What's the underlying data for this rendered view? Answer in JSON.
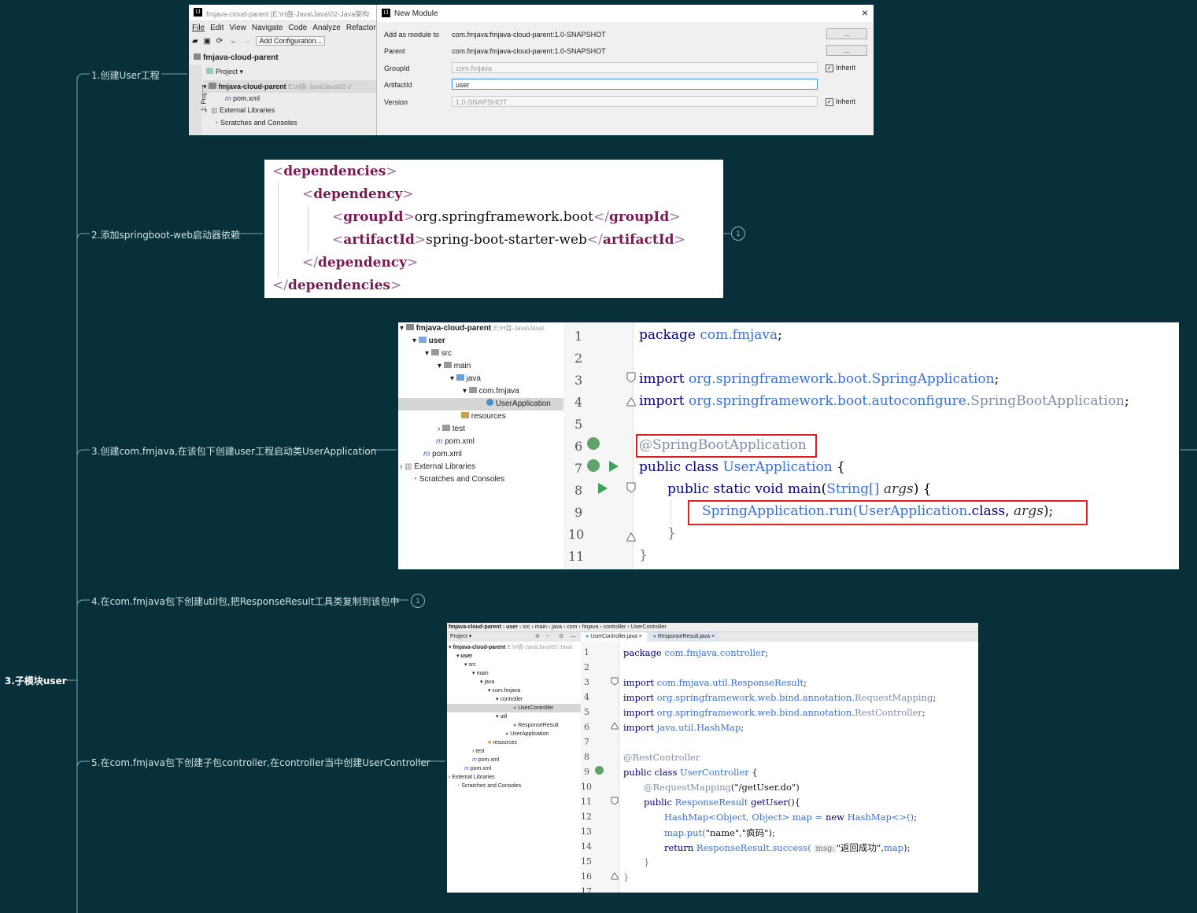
{
  "mindmap": {
    "root": "3.子模块user",
    "branches": [
      {
        "label": "1.创建User工程"
      },
      {
        "label": "2.添加springboot-web启动器依赖",
        "badge": "1"
      },
      {
        "label": "3.创建com.fmjava,在该包下创建user工程启动类UserApplication"
      },
      {
        "label": "4.在com.fmjava包下创建util包,把ResponseResult工具类复制到该包中",
        "badge": "1"
      },
      {
        "label": "5.在com.fmjava包下创建子包controller,在controller当中创建UserController"
      }
    ]
  },
  "shot1": {
    "ide_title": "fmjava-cloud-parent [E:\\H盘-Java\\Java\\02-Java架构",
    "menu": [
      "File",
      "Edit",
      "View",
      "Navigate",
      "Code",
      "Analyze",
      "Refactor"
    ],
    "add_config": "Add Configuration...",
    "project_root": "fmjava-cloud-parent",
    "project_dropdown": "Project",
    "side_tab": "1: Project",
    "tree": [
      {
        "label": "fmjava-cloud-parent",
        "hint": "E:\\H盘-Java\\Java\\02-J"
      },
      {
        "label": "pom.xml"
      },
      {
        "label": "External Libraries"
      },
      {
        "label": "Scratches and Consoles"
      }
    ],
    "dialog": {
      "title": "New Module",
      "close": "×",
      "add_as_module_label": "Add as module to",
      "add_as_module_value": "com.fmjava:fmjava-cloud-parent:1.0-SNAPSHOT",
      "parent_label": "Parent",
      "parent_value": "com.fmjava:fmjava-cloud-parent:1.0-SNAPSHOT",
      "groupid_label": "GroupId",
      "groupid_value": "com.fmjava",
      "artifactid_label": "ArtifactId",
      "artifactid_value": "user",
      "version_label": "Version",
      "version_value": "1.0-SNAPSHOT",
      "browse": "...",
      "inherit": "Inherit"
    }
  },
  "shot2": {
    "lines": [
      {
        "open": "dependencies"
      },
      {
        "open": "dependency"
      },
      {
        "tag": "groupId",
        "text": "org.springframework.boot"
      },
      {
        "tag": "artifactId",
        "text": "spring-boot-starter-web"
      },
      {
        "close": "dependency"
      },
      {
        "close": "dependencies"
      }
    ]
  },
  "shot3": {
    "tree": [
      {
        "label": "fmjava-cloud-parent",
        "hint": "E:\\H盘-Java\\Java\\"
      },
      {
        "label": "user"
      },
      {
        "label": "src"
      },
      {
        "label": "main"
      },
      {
        "label": "java"
      },
      {
        "label": "com.fmjava"
      },
      {
        "label": "UserApplication"
      },
      {
        "label": "resources"
      },
      {
        "label": "test"
      },
      {
        "label": "pom.xml"
      },
      {
        "label": "pom.xml"
      },
      {
        "label": "External Libraries"
      },
      {
        "label": "Scratches and Consoles"
      }
    ],
    "line_numbers": [
      "1",
      "2",
      "3",
      "4",
      "5",
      "6",
      "7",
      "8",
      "9",
      "10",
      "11"
    ],
    "code": {
      "l1_kw": "package",
      "l1_pk": "com.fmjava",
      "l1_end": ";",
      "l3_kw": "import",
      "l3_pk": "org.springframework.boot.",
      "l3_cls": "SpringApplication",
      "l3_end": ";",
      "l4_kw": "import",
      "l4_pk": "org.springframework.boot.autoconfigure.",
      "l4_cls": "SpringBootApplication",
      "l4_end": ";",
      "l6_ann": "@SpringBootApplication",
      "l7_kw": "public class",
      "l7_cls": "UserApplication",
      "l7_end": "{",
      "l8_kw": "public static void",
      "l8_fn": "main",
      "l8_p1": "(",
      "l8_type": "String[]",
      "l8_arg": "args",
      "l8_end": ") {",
      "l9_cls": "SpringApplication",
      "l9_fn": ".run(",
      "l9_arg1": "UserApplication",
      "l9_kw": ".class",
      "l9_sep": ", ",
      "l9_arg2": "args",
      "l9_end": ");",
      "l10": "}",
      "l11": "}"
    }
  },
  "shot4": {
    "breadcrumb": [
      "fmjava-cloud-parent",
      "user",
      "src",
      "main",
      "java",
      "com",
      "fmjava",
      "controller",
      "UserController"
    ],
    "project_dropdown": "Project",
    "tabs": [
      "UserController.java",
      "ResponseResult.java"
    ],
    "tree": [
      {
        "label": "fmjava-cloud-parent",
        "hint": "E:\\H盘-Java\\Java\\02-Java\\"
      },
      {
        "label": "user"
      },
      {
        "label": "src"
      },
      {
        "label": "main"
      },
      {
        "label": "java"
      },
      {
        "label": "com.fmjava"
      },
      {
        "label": "controller"
      },
      {
        "label": "UserController"
      },
      {
        "label": "util"
      },
      {
        "label": "ResponseResult"
      },
      {
        "label": "UserApplication"
      },
      {
        "label": "resources"
      },
      {
        "label": "test"
      },
      {
        "label": "pom.xml"
      },
      {
        "label": "pom.xml"
      },
      {
        "label": "External Libraries"
      },
      {
        "label": "Scratches and Consoles"
      }
    ],
    "line_numbers": [
      "1",
      "2",
      "3",
      "4",
      "5",
      "6",
      "7",
      "8",
      "9",
      "10",
      "11",
      "12",
      "13",
      "14",
      "15",
      "16",
      "17"
    ],
    "code": {
      "l1_kw": "package",
      "l1_pk": "com.fmjava.controller",
      "l1_end": ";",
      "l3_kw": "import",
      "l3_pk": "com.fmjava.util.",
      "l3_cls": "ResponseResult",
      "l3_end": ";",
      "l4_kw": "import",
      "l4_pk": "org.springframework.web.bind.annotation.",
      "l4_cls": "RequestMapping",
      "l4_end": ";",
      "l5_kw": "import",
      "l5_pk": "org.springframework.web.bind.annotation.",
      "l5_cls": "RestController",
      "l5_end": ";",
      "l6_kw": "import",
      "l6_pk": "java.util.",
      "l6_cls": "HashMap",
      "l6_end": ";",
      "l8_ann": "@RestController",
      "l9_kw": "public class",
      "l9_cls": "UserController",
      "l9_end": "{",
      "l10_ann": "@RequestMapping",
      "l10_p": "(",
      "l10_str": "\"/getUser.do\"",
      "l10_end": ")",
      "l11_kw": "public",
      "l11_cls": "ResponseResult",
      "l11_fn": "getUser",
      "l11_end": "(){",
      "l12_cls": "HashMap<Object, Object>",
      "l12_var": "map",
      "l12_eq": "=",
      "l12_kw": "new",
      "l12_new": "HashMap<>()",
      "l12_end": ";",
      "l13_var": "map.put(",
      "l13_s1": "\"name\"",
      "l13_sep": ",",
      "l13_s2": "\"疯码\"",
      "l13_end": ");",
      "l14_kw": "return",
      "l14_cls": "ResponseResult",
      "l14_fn": ".success(",
      "l14_hint": "msg:",
      "l14_s": "\"返回成功\"",
      "l14_sep": ",",
      "l14_var": "map",
      "l14_end": ");",
      "l15": "}",
      "l16": "}"
    }
  }
}
